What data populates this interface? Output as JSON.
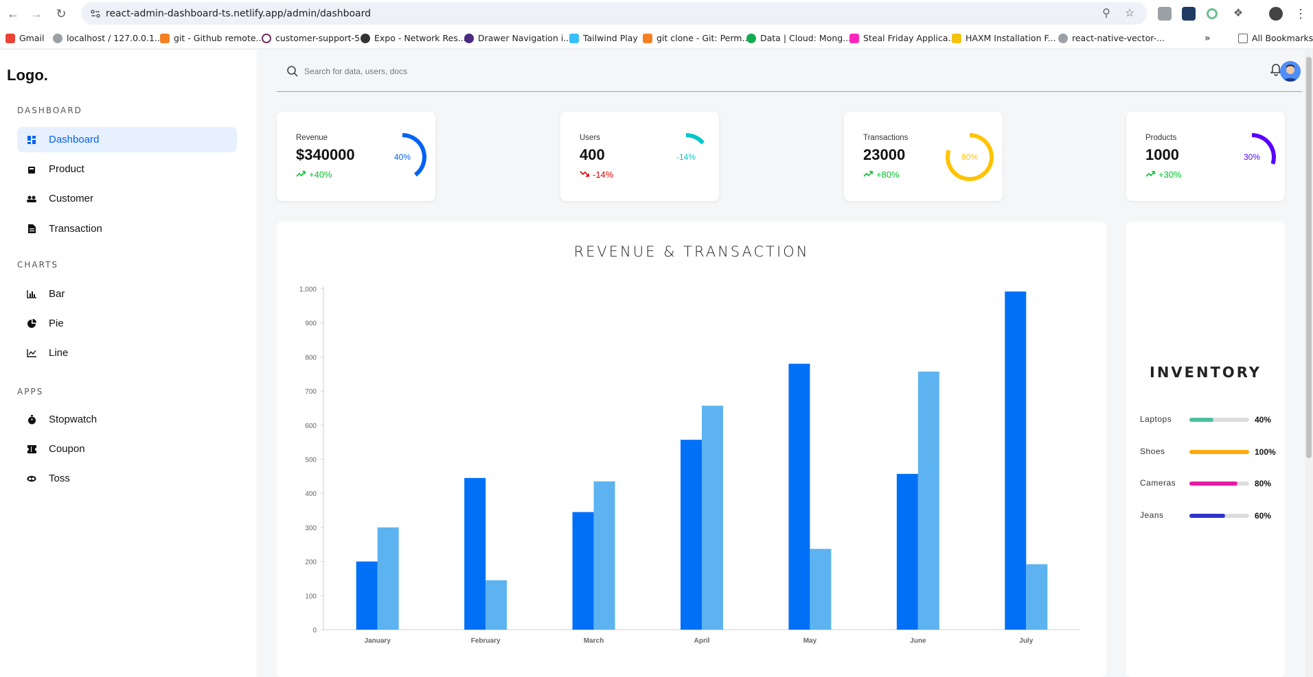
{
  "browser": {
    "url": "react-admin-dashboard-ts.netlify.app/admin/dashboard",
    "bookmarks": [
      "Gmail",
      "localhost / 127.0.0.1...",
      "git - Github remote...",
      "customer-support-5",
      "Expo - Network Res...",
      "Drawer Navigation i...",
      "Tailwind Play",
      "git clone - Git: Perm...",
      "Data | Cloud: Mong...",
      "Steal Friday Applica...",
      "HAXM Installation F...",
      "react-native-vector-..."
    ],
    "more_label": "»",
    "all_bookmarks": "All Bookmarks"
  },
  "sidebar": {
    "logo": "Logo.",
    "sections": [
      {
        "title": "DASHBOARD",
        "items": [
          {
            "label": "Dashboard",
            "icon": "dashboard-icon",
            "active": true
          },
          {
            "label": "Product",
            "icon": "bag-icon"
          },
          {
            "label": "Customer",
            "icon": "users-icon"
          },
          {
            "label": "Transaction",
            "icon": "document-icon"
          }
        ]
      },
      {
        "title": "CHARTS",
        "items": [
          {
            "label": "Bar",
            "icon": "bar-chart-icon"
          },
          {
            "label": "Pie",
            "icon": "pie-chart-icon"
          },
          {
            "label": "Line",
            "icon": "line-chart-icon"
          }
        ]
      },
      {
        "title": "APPS",
        "items": [
          {
            "label": "Stopwatch",
            "icon": "stopwatch-icon"
          },
          {
            "label": "Coupon",
            "icon": "coupon-icon"
          },
          {
            "label": "Toss",
            "icon": "coin-icon"
          }
        ]
      }
    ]
  },
  "search": {
    "placeholder": "Search for data, users, docs"
  },
  "cards": [
    {
      "label": "Revenue",
      "value": "$340000",
      "change": "+40%",
      "ring_label": "40%",
      "percent": 40,
      "trend": "up",
      "color": "#0062f5"
    },
    {
      "label": "Users",
      "value": "400",
      "change": "-14%",
      "ring_label": "-14%",
      "percent": 14,
      "trend": "down",
      "color": "#00c6ca"
    },
    {
      "label": "Transactions",
      "value": "23000",
      "change": "+80%",
      "ring_label": "80%",
      "percent": 80,
      "trend": "up",
      "color": "#ffc300"
    },
    {
      "label": "Products",
      "value": "1000",
      "change": "+30%",
      "ring_label": "30%",
      "percent": 30,
      "trend": "up",
      "color": "#5800ff"
    }
  ],
  "colors": {
    "up": "#00c22b",
    "down": "#e10000"
  },
  "chart_data": {
    "type": "bar",
    "title": "REVENUE & TRANSACTION",
    "categories": [
      "January",
      "February",
      "March",
      "April",
      "May",
      "June",
      "July"
    ],
    "series": [
      {
        "values": [
          200,
          445,
          345,
          557,
          780,
          457,
          992
        ],
        "color": "#0071f6"
      },
      {
        "values": [
          300,
          145,
          435,
          657,
          237,
          757,
          192
        ],
        "color": "#5db3ef"
      }
    ],
    "ylim": [
      0,
      1000
    ],
    "yticks": [
      "0",
      "100",
      "200",
      "300",
      "400",
      "500",
      "600",
      "700",
      "800",
      "900",
      "1,000"
    ],
    "grid": false,
    "legend": false
  },
  "inventory": {
    "title": "INVENTORY",
    "items": [
      {
        "label": "Laptops",
        "percent": 40,
        "value": "40%",
        "color": "#4dbf9b"
      },
      {
        "label": "Shoes",
        "percent": 100,
        "value": "100%",
        "color": "#ffaa0d"
      },
      {
        "label": "Cameras",
        "percent": 80,
        "value": "80%",
        "color": "#e61ba4"
      },
      {
        "label": "Jeans",
        "percent": 60,
        "value": "60%",
        "color": "#3333cc"
      }
    ]
  }
}
